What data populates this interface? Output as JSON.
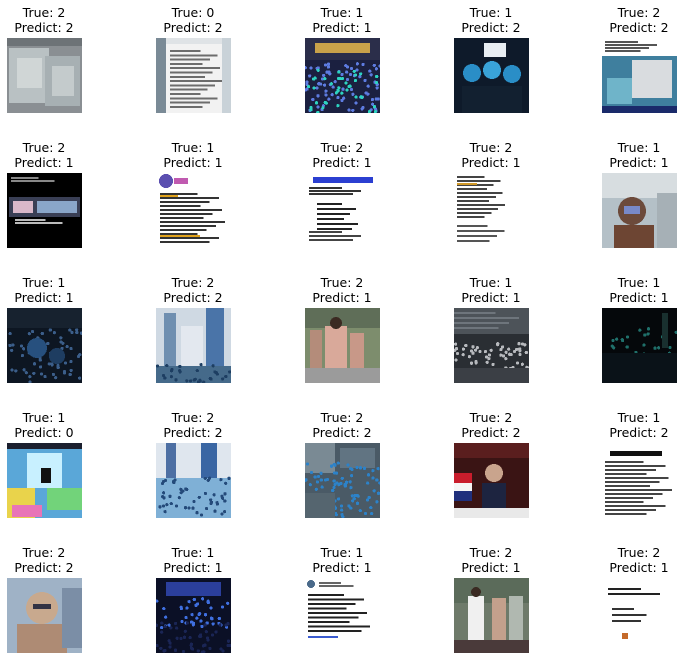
{
  "true_prefix": "True: ",
  "predict_prefix": "Predict: ",
  "samples": [
    {
      "true": 2,
      "predict": 2,
      "image": "banknotes-photo"
    },
    {
      "true": 0,
      "predict": 2,
      "image": "text-document-screenshot"
    },
    {
      "true": 1,
      "predict": 1,
      "image": "crowd-stage-night-photo"
    },
    {
      "true": 1,
      "predict": 2,
      "image": "masked-protesters-photo"
    },
    {
      "true": 2,
      "predict": 2,
      "image": "news-graphic-collage"
    },
    {
      "true": 2,
      "predict": 1,
      "image": "dark-banner-screenshot"
    },
    {
      "true": 1,
      "predict": 1,
      "image": "logo-text-post-screenshot"
    },
    {
      "true": 2,
      "predict": 1,
      "image": "blue-headline-text-post"
    },
    {
      "true": 2,
      "predict": 1,
      "image": "text-post-screenshot"
    },
    {
      "true": 1,
      "predict": 1,
      "image": "masked-person-selfie"
    },
    {
      "true": 1,
      "predict": 1,
      "image": "night-crowd-blue-photo"
    },
    {
      "true": 2,
      "predict": 2,
      "image": "ceremony-building-photo"
    },
    {
      "true": 2,
      "predict": 1,
      "image": "uniformed-officials-walking"
    },
    {
      "true": 1,
      "predict": 1,
      "image": "crowd-under-roof-photo"
    },
    {
      "true": 1,
      "predict": 1,
      "image": "dark-street-night-photo"
    },
    {
      "true": 1,
      "predict": 0,
      "image": "colorful-graphic-poster"
    },
    {
      "true": 2,
      "predict": 2,
      "image": "uniformed-group-photo"
    },
    {
      "true": 2,
      "predict": 2,
      "image": "aerial-crowd-photo"
    },
    {
      "true": 2,
      "predict": 2,
      "image": "official-with-flag-photo"
    },
    {
      "true": 1,
      "predict": 2,
      "image": "text-document-redacted"
    },
    {
      "true": 2,
      "predict": 2,
      "image": "portrait-man-glasses"
    },
    {
      "true": 1,
      "predict": 1,
      "image": "concert-crowd-blue-lights"
    },
    {
      "true": 1,
      "predict": 1,
      "image": "social-text-post"
    },
    {
      "true": 2,
      "predict": 1,
      "image": "officials-standing-photo"
    },
    {
      "true": 2,
      "predict": 1,
      "image": "sparse-text-document"
    }
  ]
}
